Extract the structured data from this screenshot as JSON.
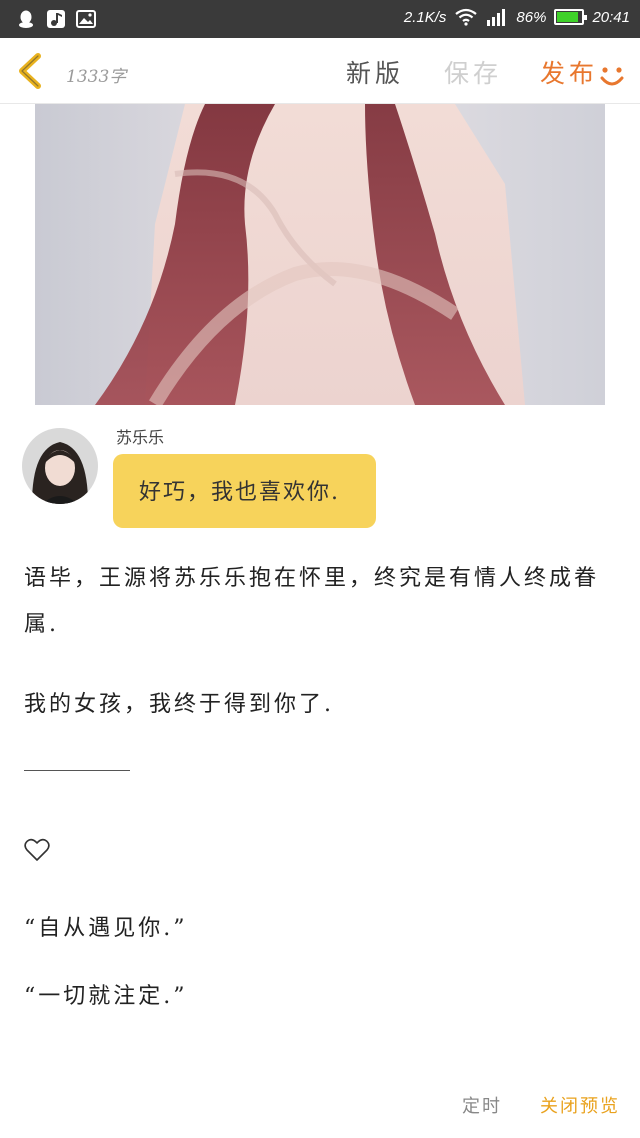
{
  "status_bar": {
    "speed": "2.1K/s",
    "battery": "86%",
    "battery_level": 0.86,
    "time": "20:41",
    "icons": [
      "qq-icon",
      "music-note-icon",
      "image-icon",
      "wifi-icon",
      "signal-icon",
      "battery-icon"
    ]
  },
  "toolbar": {
    "word_count": "1333字",
    "new_version": "新版",
    "save": "保存",
    "publish": "发布",
    "accent": "#e8772e"
  },
  "chat": {
    "name": "苏乐乐",
    "message": "好巧，我也喜欢你.",
    "bubble_color": "#f7d35b"
  },
  "body": {
    "paragraph1": "语毕，王源将苏乐乐抱在怀里，终究是有情人终成眷属.",
    "paragraph2": "我的女孩，我终于得到你了.",
    "quote1": "“自从遇见你.”",
    "quote2": "“一切就注定.”"
  },
  "bottom": {
    "schedule": "定时",
    "close_preview": "关闭预览"
  }
}
